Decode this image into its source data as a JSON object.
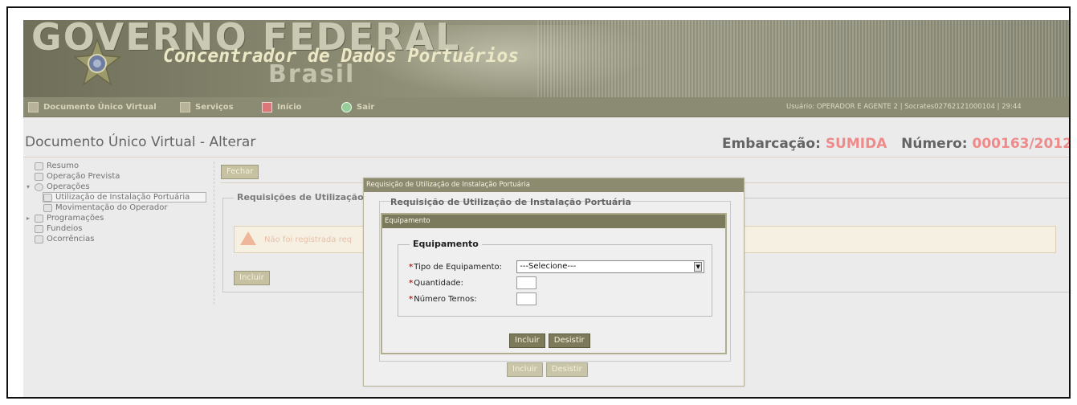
{
  "banner": {
    "gov_title": "GOVERNO FEDERAL",
    "subtitle": "Concentrador de Dados Portuários",
    "country": "Brasil"
  },
  "topnav": {
    "items": [
      {
        "label": "Documento Único Virtual",
        "icon": "document-icon"
      },
      {
        "label": "Serviços",
        "icon": "services-icon"
      },
      {
        "label": "Início",
        "icon": "home-icon"
      },
      {
        "label": "Sair",
        "icon": "exit-icon"
      }
    ],
    "user_info": "Usuário: OPERADOR E AGENTE 2   | Socrates02762121000104 |   29:44"
  },
  "page": {
    "title": "Documento Único Virtual - Alterar",
    "vessel_label": "Embarcação:",
    "vessel_name": "SUMIDA",
    "number_label": "Número:",
    "number_value": "000163/2012"
  },
  "tree": [
    {
      "label": "Resumo",
      "level": 0
    },
    {
      "label": "Operação Prevista",
      "level": 0
    },
    {
      "label": "Operações",
      "level": 0
    },
    {
      "label": "Utilização de Instalação Portuária",
      "level": 1
    },
    {
      "label": "Movimentação do Operador",
      "level": 1
    },
    {
      "label": "Programações",
      "level": 0
    },
    {
      "label": "Fundeios",
      "level": 0
    },
    {
      "label": "Ocorrências",
      "level": 0
    }
  ],
  "main": {
    "close_button": "Fechar",
    "section_legend": "Requisições de Utilização de",
    "warning": "Não foi registrada req",
    "include_button": "Incluir"
  },
  "outer_modal": {
    "title": "Requisição de Utilização de Instalação Portuária",
    "legend": "Requisição de Utilização de Instalação Portuária",
    "include_button": "Incluir",
    "cancel_button": "Desistir"
  },
  "inner_modal": {
    "title": "Equipamento",
    "legend": "Equipamento",
    "fields": {
      "tipo_label": "Tipo de Equipamento:",
      "tipo_value": "---Selecione---",
      "quantidade_label": "Quantidade:",
      "ternos_label": "Número Ternos:"
    },
    "include_button": "Incluir",
    "cancel_button": "Desistir"
  },
  "colors": {
    "accent_red": "#ef8a8a",
    "modal_title": "#7c7a5c",
    "button": "#7c7a5a"
  }
}
